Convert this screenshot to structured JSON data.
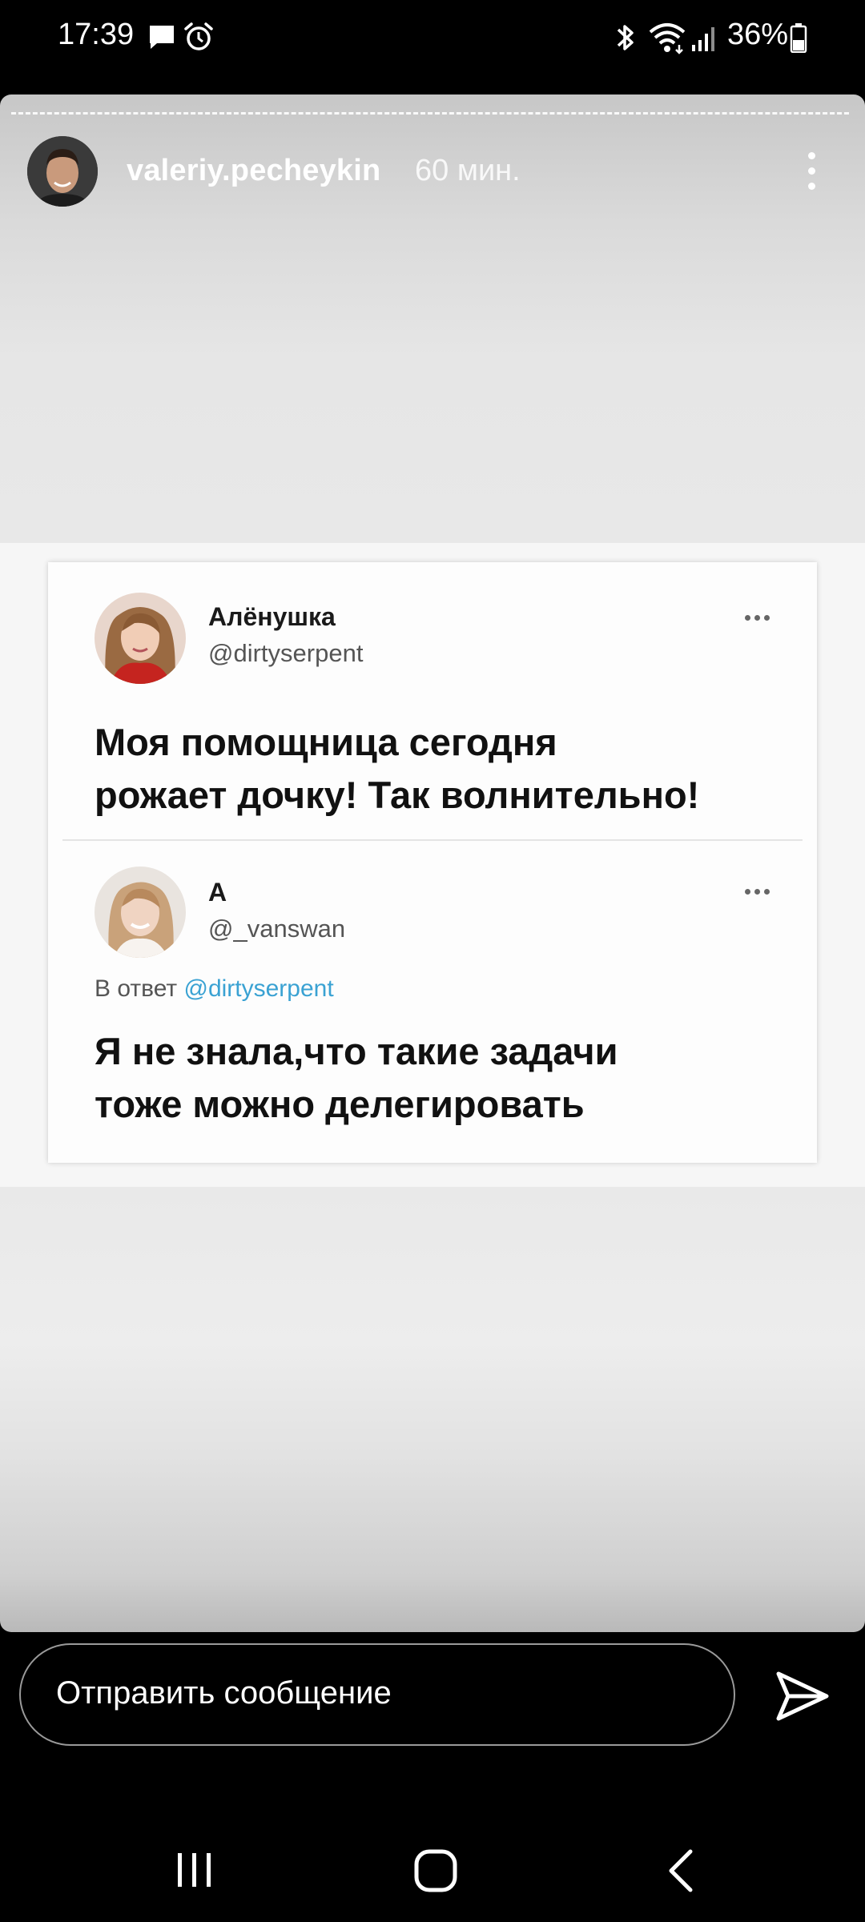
{
  "status_bar": {
    "time": "17:39",
    "battery": "36%",
    "icons": [
      "message-icon",
      "alarm-icon",
      "bluetooth-icon",
      "wifi-icon",
      "signal-icon",
      "battery-icon"
    ]
  },
  "story": {
    "username": "valeriy.pecheykin",
    "time_ago": "60 мин.",
    "menu_icon": "more-vertical-icon"
  },
  "tweets": [
    {
      "name": "Алёнушка",
      "handle": "@dirtyserpent",
      "text_line1": "Моя помощница сегодня",
      "text_line2": "рожает дочку! Так волнительно!"
    },
    {
      "name": "A",
      "handle": "@_vanswan",
      "reply_prefix": "В ответ",
      "reply_mention": "@dirtyserpent",
      "text_line1": "Я не знала,что такие задачи",
      "text_line2": "тоже можно делегировать"
    }
  ],
  "message_bar": {
    "placeholder": "Отправить сообщение",
    "send_icon": "send-icon"
  },
  "nav_bar": {
    "buttons": [
      "recents-icon",
      "home-icon",
      "back-icon"
    ]
  }
}
